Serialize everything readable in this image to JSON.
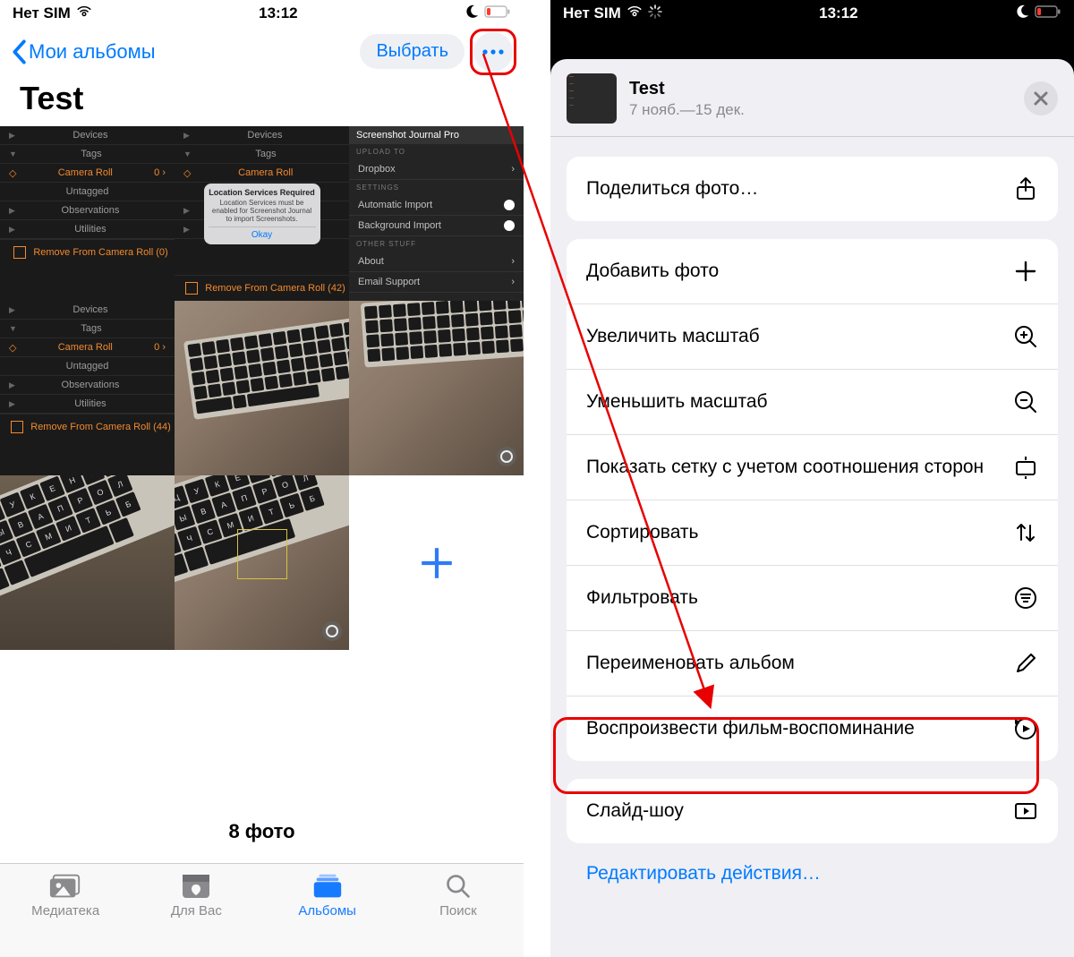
{
  "status": {
    "carrier": "Нет SIM",
    "time": "13:12"
  },
  "screen1": {
    "back_label": "Мои альбомы",
    "select_label": "Выбрать",
    "album_title": "Test",
    "thumb_list": {
      "devices": "Devices",
      "tags": "Tags",
      "camera_roll": "Camera Roll",
      "untagged": "Untagged",
      "observations": "Observations",
      "utilities": "Utilities",
      "remove0": "Remove From Camera Roll (0)",
      "remove42": "Remove From Camera Roll (42)",
      "remove44": "Remove From Camera Roll (44)",
      "cnt0": "0"
    },
    "thumb_modal": {
      "title": "Location Services Required",
      "body": "Location Services must be enabled for Screenshot Journal to import Screenshots.",
      "okay": "Okay"
    },
    "thumb_settings": {
      "header": "Screenshot Journal Pro",
      "upload": "UPLOAD TO",
      "dropbox": "Dropbox",
      "settings": "SETTINGS",
      "auto": "Automatic Import",
      "bg": "Background Import",
      "other": "OTHER STUFF",
      "about": "About",
      "email": "Email Support"
    },
    "count_label": "8 фото",
    "tabs": {
      "library": "Медиатека",
      "for_you": "Для Вас",
      "albums": "Альбомы",
      "search": "Поиск"
    }
  },
  "screen2": {
    "sheet_title": "Test",
    "sheet_sub": "7 нояб.—15 дек.",
    "share": "Поделиться фото…",
    "add": "Добавить фото",
    "zoom_in": "Увеличить масштаб",
    "zoom_out": "Уменьшить масштаб",
    "aspect": "Показать сетку с учетом соотношения сторон",
    "sort": "Сортировать",
    "filter": "Фильтровать",
    "rename": "Переименовать альбом",
    "memory": "Воспроизвести фильм-воспоминание",
    "slideshow": "Слайд-шоу",
    "edit_actions": "Редактировать действия…"
  }
}
